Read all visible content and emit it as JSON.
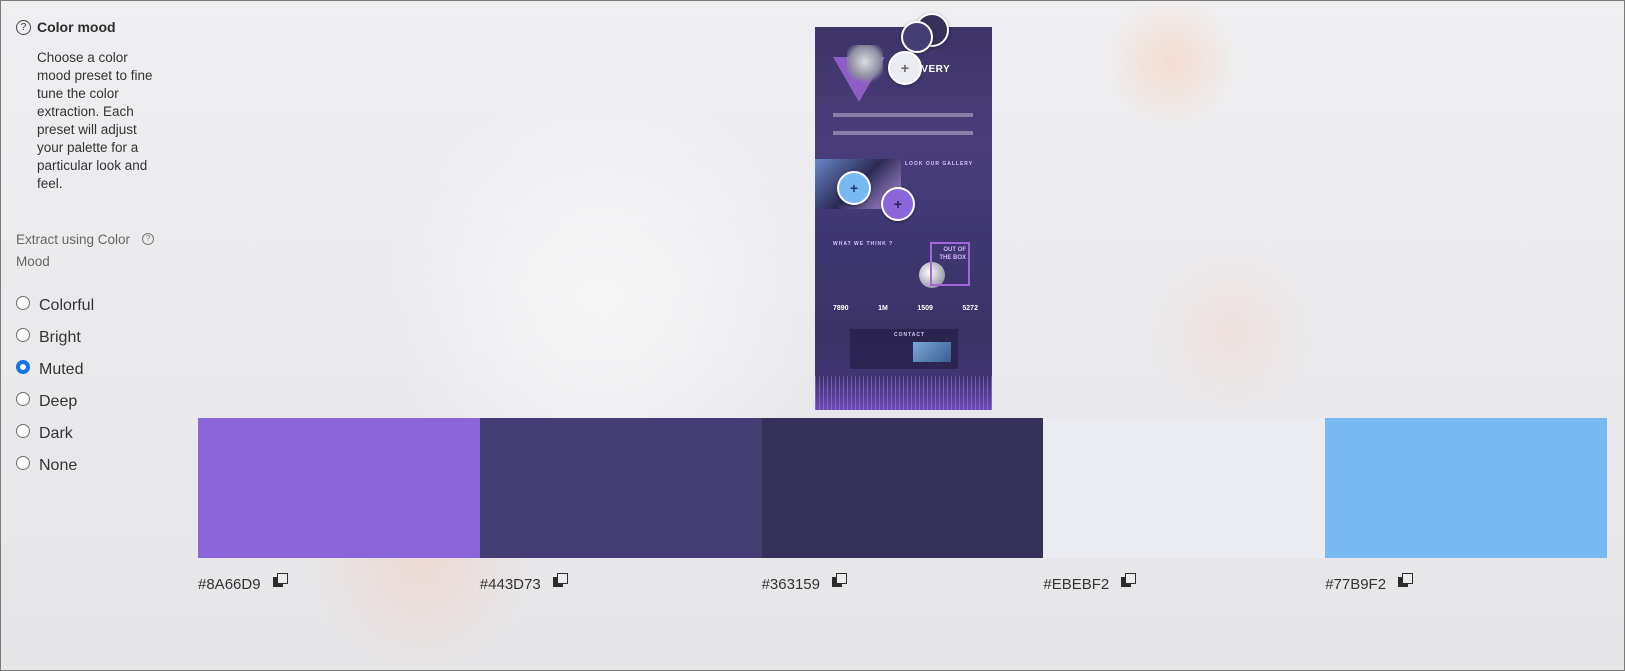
{
  "sidebar": {
    "help_icon": "?",
    "title": "Color mood",
    "description": "Choose a color mood preset to fine tune the color extraction. Each preset will adjust your palette for a particular look and feel.",
    "extract_label": "Extract using Color Mood",
    "info_icon": "?",
    "moods": [
      {
        "label": "Colorful",
        "selected": false
      },
      {
        "label": "Bright",
        "selected": false
      },
      {
        "label": "Muted",
        "selected": true
      },
      {
        "label": "Deep",
        "selected": false
      },
      {
        "label": "Dark",
        "selected": false
      },
      {
        "label": "None",
        "selected": false
      }
    ]
  },
  "preview": {
    "hero_title": "OVERY",
    "gallery_title": "LOOK OUR GALLERY",
    "section_title": "WHAT WE THINK ?",
    "box_text": "OUT OF THE BOX",
    "stats": [
      "7890",
      "1M",
      "1509",
      "5272"
    ],
    "contact_title": "CONTACT",
    "pin_icon": "+"
  },
  "palette": {
    "swatches": [
      {
        "hex": "#8A66D9",
        "color": "#8A66D9"
      },
      {
        "hex": "#443D73",
        "color": "#443D73"
      },
      {
        "hex": "#363159",
        "color": "#363159"
      },
      {
        "hex": "#EBEBF2",
        "color": "#EBEBF2"
      },
      {
        "hex": "#77B9F2",
        "color": "#77B9F2"
      }
    ]
  }
}
